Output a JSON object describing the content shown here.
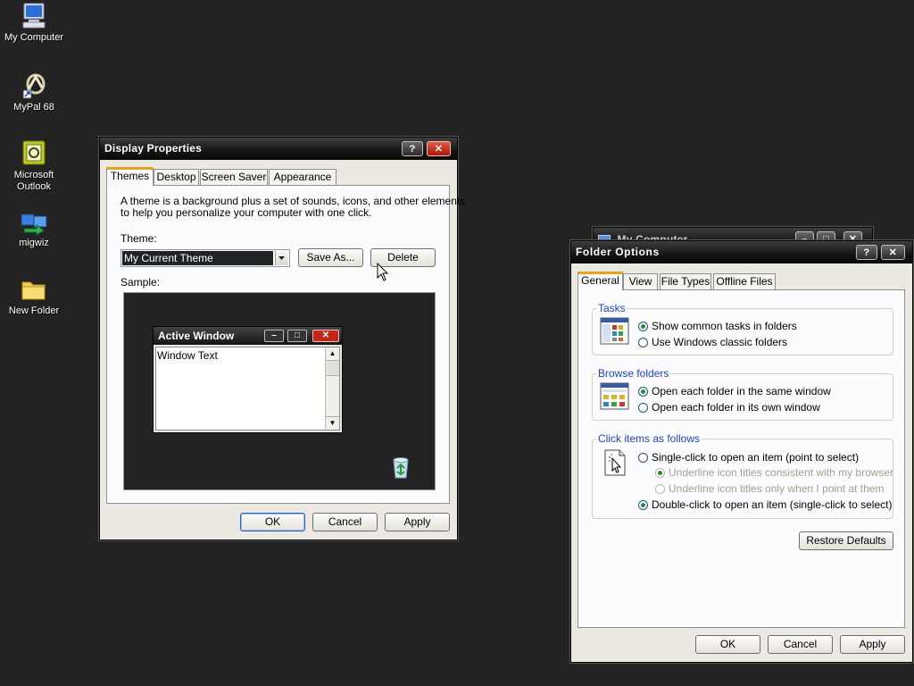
{
  "desktop": {
    "icons": [
      {
        "label": "My Computer",
        "icon": "computer-icon"
      },
      {
        "label": "MyPal 68",
        "icon": "mypal-icon"
      },
      {
        "label": "Microsoft Outlook",
        "icon": "outlook-icon"
      },
      {
        "label": "migwiz",
        "icon": "migwiz-icon"
      },
      {
        "label": "New Folder",
        "icon": "folder-icon"
      }
    ]
  },
  "background_window": {
    "title": "My Computer"
  },
  "display_properties": {
    "title": "Display Properties",
    "title_buttons": {
      "help": "?",
      "close": "✕"
    },
    "tabs": [
      {
        "label": "Themes",
        "active": true
      },
      {
        "label": "Desktop",
        "active": false
      },
      {
        "label": "Screen Saver",
        "active": false
      },
      {
        "label": "Appearance",
        "active": false
      }
    ],
    "description_line1": "A theme is a background plus a set of sounds, icons, and other elements",
    "description_line2": "to help you personalize your computer with one click.",
    "theme_label": "Theme:",
    "theme_value": "My Current Theme",
    "save_as_label": "Save As...",
    "delete_label": "Delete",
    "sample_label": "Sample:",
    "sample": {
      "active_window_title": "Active Window",
      "window_text": "Window Text"
    },
    "ok_label": "OK",
    "cancel_label": "Cancel",
    "apply_label": "Apply"
  },
  "folder_options": {
    "title": "Folder Options",
    "title_buttons": {
      "help": "?",
      "close": "✕"
    },
    "tabs": [
      {
        "label": "General",
        "active": true
      },
      {
        "label": "View",
        "active": false
      },
      {
        "label": "File Types",
        "active": false
      },
      {
        "label": "Offline Files",
        "active": false
      }
    ],
    "tasks": {
      "title": "Tasks",
      "options": [
        {
          "label": "Show common tasks in folders",
          "selected": true
        },
        {
          "label": "Use Windows classic folders",
          "selected": false
        }
      ]
    },
    "browse": {
      "title": "Browse folders",
      "options": [
        {
          "label": "Open each folder in the same window",
          "selected": true
        },
        {
          "label": "Open each folder in its own window",
          "selected": false
        }
      ]
    },
    "click": {
      "title": "Click items as follows",
      "single": "Single-click to open an item (point to select)",
      "underline_browser": "Underline icon titles consistent with my browser",
      "underline_point": "Underline icon titles only when I point at them",
      "double": "Double-click to open an item (single-click to select)"
    },
    "restore_defaults_label": "Restore Defaults",
    "ok_label": "OK",
    "cancel_label": "Cancel",
    "apply_label": "Apply"
  }
}
